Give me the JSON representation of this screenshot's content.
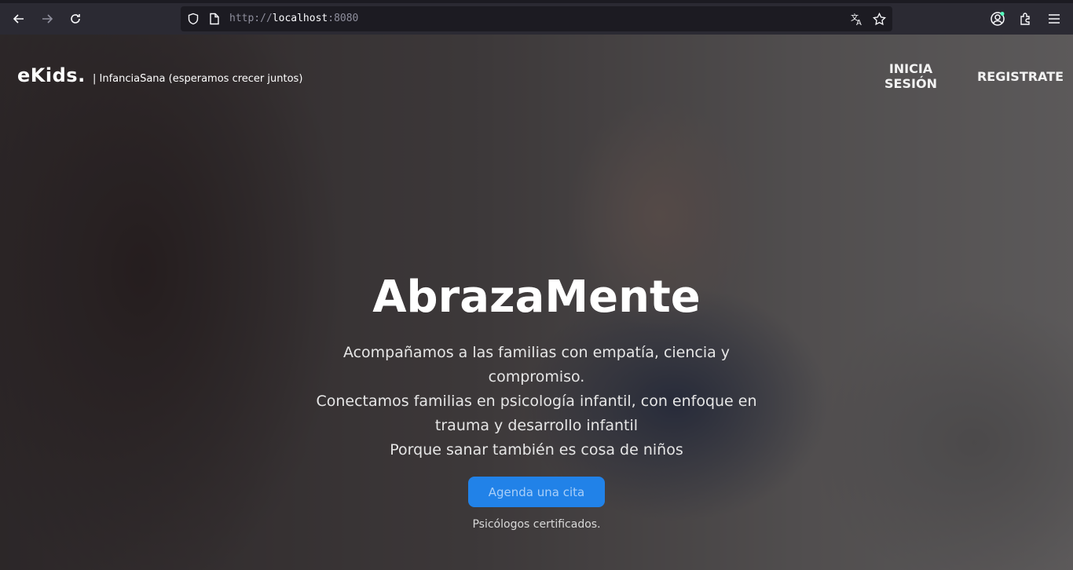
{
  "browser": {
    "url_scheme": "http://",
    "url_host": "localhost",
    "url_port": ":8080",
    "icons": [
      "back-icon",
      "forward-icon",
      "reload-icon",
      "shield-icon",
      "page-icon",
      "translate-icon",
      "star-icon",
      "account-icon",
      "extensions-icon",
      "menu-icon"
    ]
  },
  "header": {
    "brand": "eKids.",
    "tagline": "| InfanciaSana (esperamos crecer juntos)",
    "login_line1": "INICIA",
    "login_line2": "SESIÓN",
    "register": "REGISTRATE"
  },
  "hero": {
    "title": "AbrazaMente",
    "line1": "Acompañamos a las familias con empatía, ciencia y compromiso.",
    "line2": "Conectamos familias en psicología infantil, con enfoque en trauma y desarrollo infantil",
    "line3": "Porque sanar también es cosa de niños",
    "cta": "Agenda una cita",
    "note": "Psicólogos certificados."
  },
  "colors": {
    "accent": "#2182e8",
    "chrome": "#2b2a33",
    "urlbar": "#1c1b22"
  }
}
